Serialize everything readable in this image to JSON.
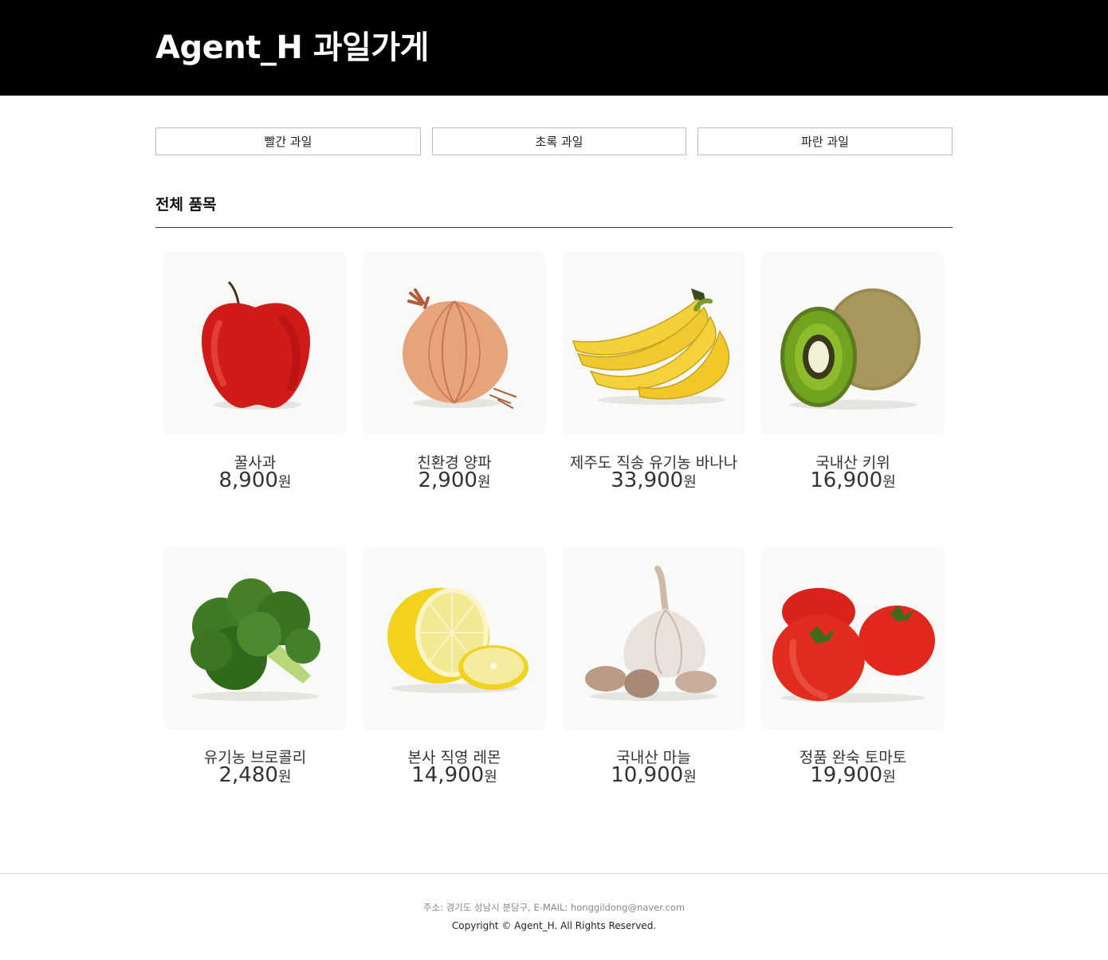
{
  "header": {
    "title": "Agent_H 과일가게"
  },
  "categories": [
    {
      "label": "빨간 과일"
    },
    {
      "label": "초록 과일"
    },
    {
      "label": "파란 과일"
    }
  ],
  "section": {
    "title": "전체 품목"
  },
  "products": [
    {
      "name": "꿀사과",
      "price": "8,900",
      "unit": "원",
      "image": "apple"
    },
    {
      "name": "친환경 양파",
      "price": "2,900",
      "unit": "원",
      "image": "onion"
    },
    {
      "name": "제주도 직송 유기농 바나나",
      "price": "33,900",
      "unit": "원",
      "image": "banana"
    },
    {
      "name": "국내산 키위",
      "price": "16,900",
      "unit": "원",
      "image": "kiwi"
    },
    {
      "name": "유기농 브로콜리",
      "price": "2,480",
      "unit": "원",
      "image": "broccoli"
    },
    {
      "name": "본사 직영 레몬",
      "price": "14,900",
      "unit": "원",
      "image": "lemon"
    },
    {
      "name": "국내산 마늘",
      "price": "10,900",
      "unit": "원",
      "image": "garlic"
    },
    {
      "name": "정품 완숙 토마토",
      "price": "19,900",
      "unit": "원",
      "image": "tomato"
    }
  ],
  "footer": {
    "address": "주소: 경기도 성남시 분당구, E-MAIL: honggildong@naver.com",
    "copyright": "Copyright © Agent_H. All Rights Reserved."
  }
}
